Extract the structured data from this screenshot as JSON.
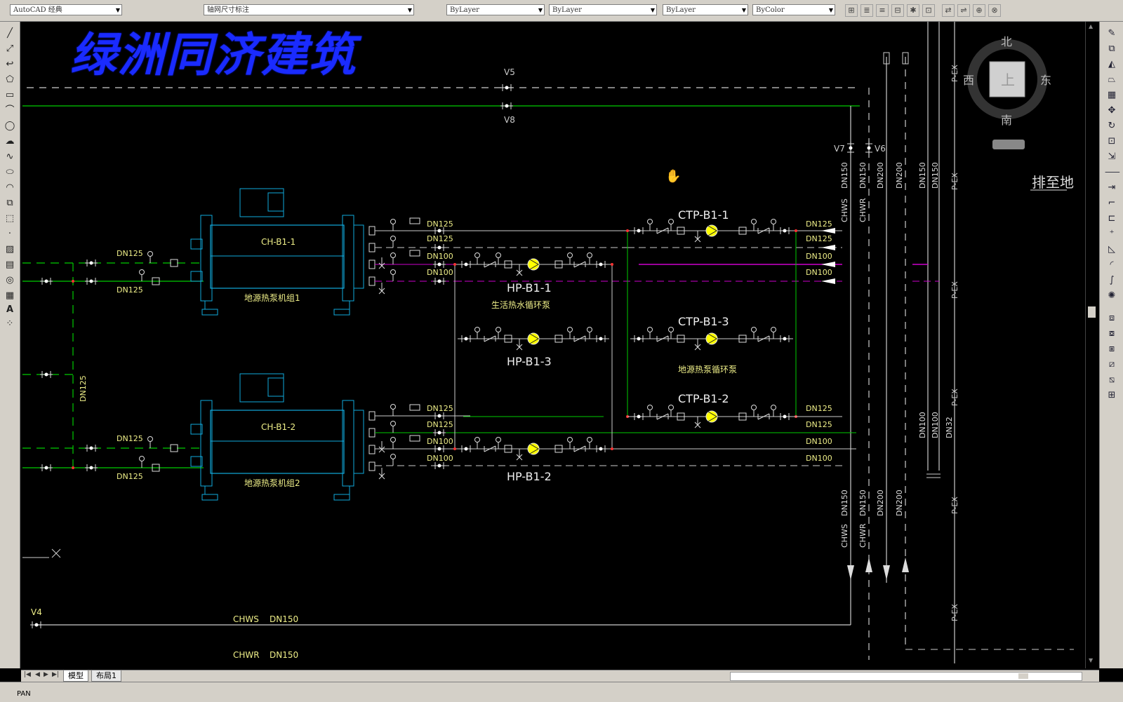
{
  "toolbar": {
    "app_field": "AutoCAD 经典",
    "layer_field": "轴网尺寸标注",
    "color_field": "ByLayer",
    "linetype_field": "ByLayer",
    "lineweight_field": "ByLayer",
    "plotstyle_field": "ByColor"
  },
  "watermark": "绿洲同济建筑",
  "viewcube": {
    "north": "北",
    "south": "南",
    "east": "东",
    "west": "西",
    "face": "上"
  },
  "drawing": {
    "valves": {
      "v4": "V4",
      "v5": "V5",
      "v6": "V6",
      "v7": "V7",
      "v8": "V8"
    },
    "chillers": [
      {
        "tag": "CH-B1-1",
        "desc": "地源热泵机组1"
      },
      {
        "tag": "CH-B1-2",
        "desc": "地源热泵机组2"
      }
    ],
    "hot_water_pumps": {
      "p1": "HP-B1-1",
      "p2": "HP-B1-3",
      "p3": "HP-B1-2",
      "desc": "生活热水循环泵"
    },
    "circ_pumps": {
      "p1": "CTP-B1-1",
      "p2": "CTP-B1-3",
      "p3": "CTP-B1-2",
      "desc": "地源热泵循环泵"
    },
    "dn": {
      "dn32": "DN32",
      "dn100": "DN100",
      "dn125": "DN125",
      "dn150": "DN150",
      "dn200": "DN200"
    },
    "pipes": {
      "chws": "CHWS",
      "chwr": "CHWR",
      "pex": "P-EX",
      "drain": "排至地"
    }
  },
  "tabs": {
    "model": "模型",
    "layout1": "布局1"
  },
  "command": {
    "text": "PAN"
  }
}
